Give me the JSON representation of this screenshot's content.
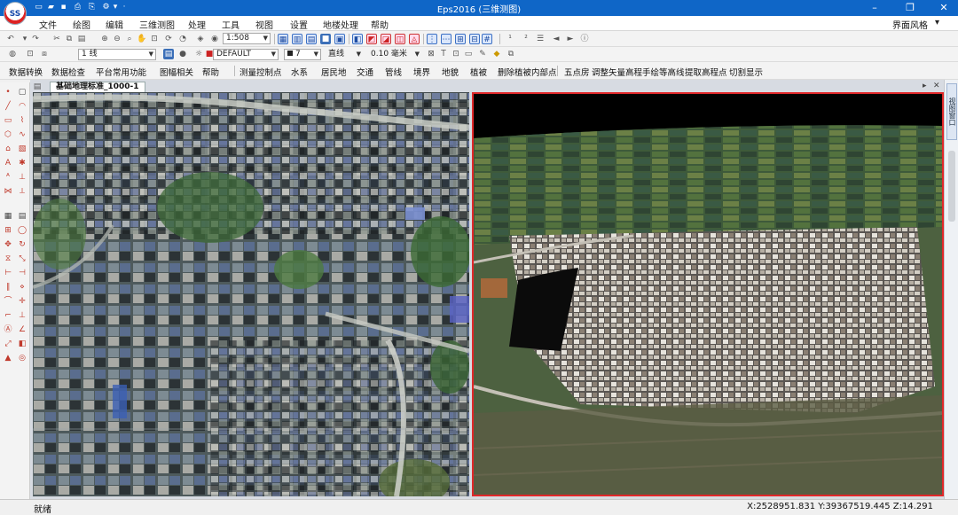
{
  "app": {
    "logo_text": "SS",
    "title": "Eps2016 (三维测图)",
    "ui_style_label": "界面风格"
  },
  "menu": [
    "文件",
    "绘图",
    "编辑",
    "三维测图",
    "处理",
    "工具",
    "视图",
    "设置",
    "地楼处理",
    "帮助"
  ],
  "toolbar1": {
    "scale": "1:508"
  },
  "toolbar2": {
    "line_type": "1 线",
    "layer": "DEFAULT",
    "color_index": "7",
    "line_style": "直线",
    "line_width": "0.10 毫米"
  },
  "command_bar": {
    "left": [
      "数据转换",
      "数据检查",
      "平台常用功能",
      "图幅相关",
      "帮助"
    ],
    "features": [
      "测量控制点",
      "水系",
      "居民地",
      "交通",
      "管线",
      "境界",
      "地貌",
      "植被",
      "删除植被内部点"
    ],
    "tools": [
      "五点房",
      "调整矢量高程",
      "手绘等高线",
      "提取高程点",
      "切割显示"
    ]
  },
  "document": {
    "tab_label": "基础地理标准_1000-1"
  },
  "side_panel": {
    "tab_label": "视图窗口"
  },
  "status": {
    "state": "就绪",
    "coordinates": "X:2528951.831  Y:39367519.445  Z:14.291"
  },
  "colors": {
    "title_bar": "#0f66c7",
    "active_view_border": "#e0282a"
  }
}
